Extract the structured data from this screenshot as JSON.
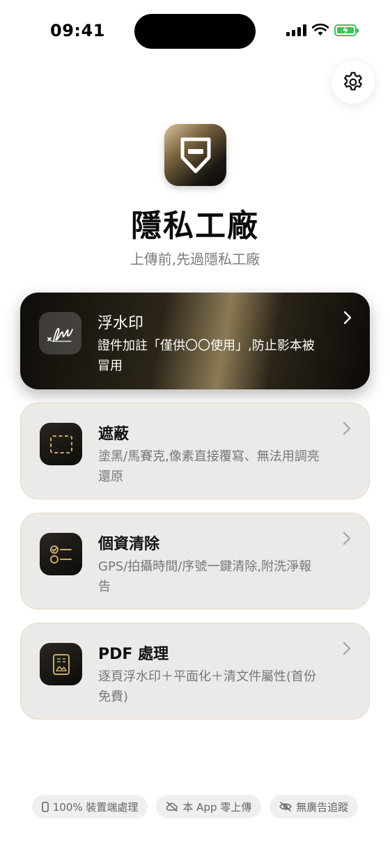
{
  "status_bar": {
    "time": "09:41",
    "battery_color": "#34c759"
  },
  "settings": {
    "icon": "gear-icon"
  },
  "app": {
    "title": "隱私工廠",
    "subtitle": "上傳前,先過隱私工廠",
    "icon": "shield-icon"
  },
  "cards": [
    {
      "title": "浮水印",
      "desc": "證件加註「僅供〇〇使用」,防止影本被冒用",
      "icon": "signature-icon"
    },
    {
      "title": "遮蔽",
      "desc": "塗黑/馬賽克,像素直接覆寫、無法用調亮還原",
      "icon": "dashed-frame-icon"
    },
    {
      "title": "個資清除",
      "desc": "GPS/拍攝時間/序號一鍵清除,附洗淨報告",
      "icon": "checklist-icon"
    },
    {
      "title": "PDF 處理",
      "desc": "逐頁浮水印＋平面化＋清文件屬性(首份免費)",
      "icon": "document-icon"
    }
  ],
  "pills": [
    {
      "label": "100% 裝置端處理",
      "icon": "phone-icon"
    },
    {
      "label": "本 App 零上傳",
      "icon": "cloud-off-icon"
    },
    {
      "label": "無廣告追蹤",
      "icon": "eye-off-icon"
    }
  ],
  "colors": {
    "accent_gold": "#c8a96a",
    "card_bg": "#eceae8"
  }
}
